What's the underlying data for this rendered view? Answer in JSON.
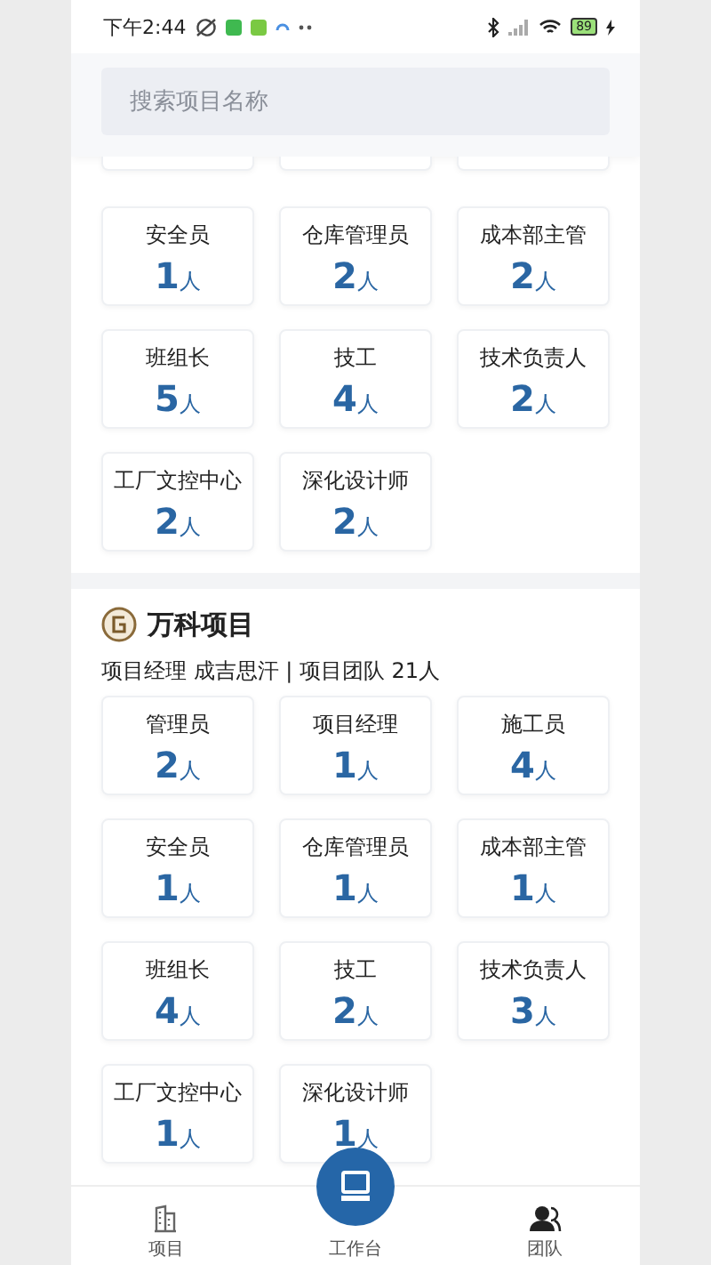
{
  "status_bar": {
    "time": "下午2:44",
    "battery": "89"
  },
  "search": {
    "placeholder": "搜索项目名称"
  },
  "sections": [
    {
      "roles": [
        {
          "label": "安全员",
          "count": "1",
          "unit": "人"
        },
        {
          "label": "仓库管理员",
          "count": "2",
          "unit": "人"
        },
        {
          "label": "成本部主管",
          "count": "2",
          "unit": "人"
        },
        {
          "label": "班组长",
          "count": "5",
          "unit": "人"
        },
        {
          "label": "技工",
          "count": "4",
          "unit": "人"
        },
        {
          "label": "技术负责人",
          "count": "2",
          "unit": "人"
        },
        {
          "label": "工厂文控中心",
          "count": "2",
          "unit": "人"
        },
        {
          "label": "深化设计师",
          "count": "2",
          "unit": "人"
        }
      ]
    },
    {
      "title": "万科项目",
      "subtitle": "项目经理 成吉思汗 | 项目团队 21人",
      "roles": [
        {
          "label": "管理员",
          "count": "2",
          "unit": "人"
        },
        {
          "label": "项目经理",
          "count": "1",
          "unit": "人"
        },
        {
          "label": "施工员",
          "count": "4",
          "unit": "人"
        },
        {
          "label": "安全员",
          "count": "1",
          "unit": "人"
        },
        {
          "label": "仓库管理员",
          "count": "1",
          "unit": "人"
        },
        {
          "label": "成本部主管",
          "count": "1",
          "unit": "人"
        },
        {
          "label": "班组长",
          "count": "4",
          "unit": "人"
        },
        {
          "label": "技工",
          "count": "2",
          "unit": "人"
        },
        {
          "label": "技术负责人",
          "count": "3",
          "unit": "人"
        },
        {
          "label": "工厂文控中心",
          "count": "1",
          "unit": "人"
        },
        {
          "label": "深化设计师",
          "count": "1",
          "unit": "人"
        }
      ]
    }
  ],
  "nav": [
    {
      "label": "项目",
      "kind": "building"
    },
    {
      "label": "工作台",
      "kind": "computer"
    },
    {
      "label": "团队",
      "kind": "people"
    }
  ]
}
